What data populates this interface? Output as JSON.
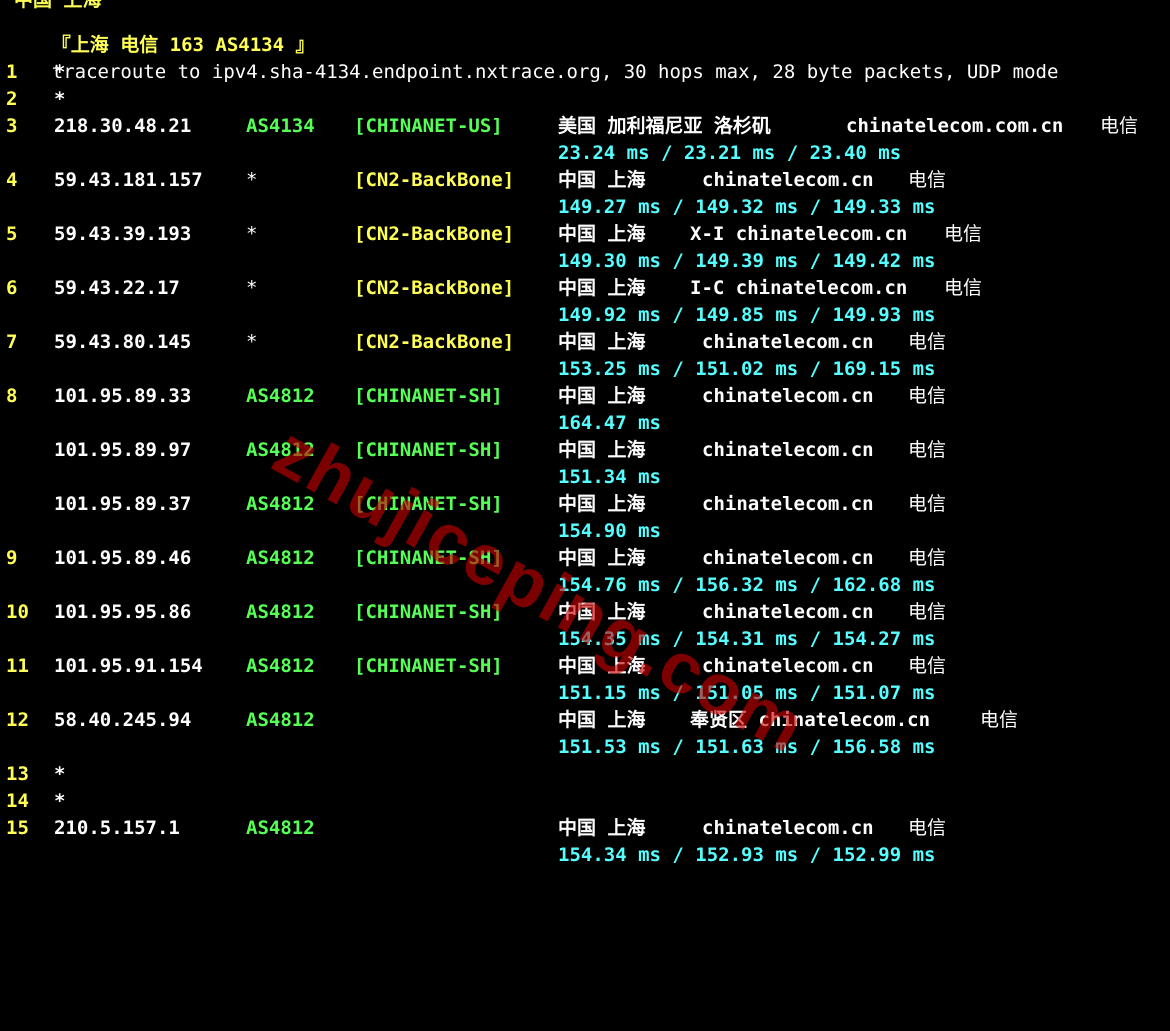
{
  "colors": {
    "background": "#000000",
    "text": "#ffffff",
    "hop": "#ffff55",
    "asn": "#55ff55",
    "tag_green": "#55ff55",
    "tag_yellow": "#ffff55",
    "rtt": "#55ffff",
    "watermark": "#c80000"
  },
  "cut_off_text": "中国 上海",
  "header": "『上海 电信 163 AS4134 』",
  "traceroute_line": "traceroute to ipv4.sha-4134.endpoint.nxtrace.org, 30 hops max, 28 byte packets, UDP mode",
  "hops": {
    "h1": {
      "hop": "1",
      "ip": "*"
    },
    "h2": {
      "hop": "2",
      "ip": "*"
    },
    "h3": {
      "hop": "3",
      "ip": "218.30.48.21",
      "asn": "AS4134",
      "tag": "[CHINANET-US]",
      "geo": "美国 加利福尼亚 洛杉矶",
      "host": "chinatelecom.com.cn",
      "isp": "电信",
      "rtt": "23.24 ms / 23.21 ms / 23.40 ms"
    },
    "h4": {
      "hop": "4",
      "ip": "59.43.181.157",
      "asn": "*",
      "tag": "[CN2-BackBone]",
      "geo": "中国 上海",
      "host": "chinatelecom.cn",
      "isp": "电信",
      "rtt": "149.27 ms / 149.32 ms / 149.33 ms"
    },
    "h5": {
      "hop": "5",
      "ip": "59.43.39.193",
      "asn": "*",
      "tag": "[CN2-BackBone]",
      "geo": "中国 上海",
      "host": "X-I chinatelecom.cn",
      "isp": "电信",
      "rtt": "149.30 ms / 149.39 ms / 149.42 ms"
    },
    "h6": {
      "hop": "6",
      "ip": "59.43.22.17",
      "asn": "*",
      "tag": "[CN2-BackBone]",
      "geo": "中国 上海",
      "host": "I-C chinatelecom.cn",
      "isp": "电信",
      "rtt": "149.92 ms / 149.85 ms / 149.93 ms"
    },
    "h7": {
      "hop": "7",
      "ip": "59.43.80.145",
      "asn": "*",
      "tag": "[CN2-BackBone]",
      "geo": "中国 上海",
      "host": "chinatelecom.cn",
      "isp": "电信",
      "rtt": "153.25 ms / 151.02 ms / 169.15 ms"
    },
    "h8a": {
      "hop": "8",
      "ip": "101.95.89.33",
      "asn": "AS4812",
      "tag": "[CHINANET-SH]",
      "geo": "中国 上海",
      "host": "chinatelecom.cn",
      "isp": "电信",
      "rtt": "164.47 ms"
    },
    "h8b": {
      "ip": "101.95.89.97",
      "asn": "AS4812",
      "tag": "[CHINANET-SH]",
      "geo": "中国 上海",
      "host": "chinatelecom.cn",
      "isp": "电信",
      "rtt": "151.34 ms"
    },
    "h8c": {
      "ip": "101.95.89.37",
      "asn": "AS4812",
      "tag": "[CHINANET-SH]",
      "geo": "中国 上海",
      "host": "chinatelecom.cn",
      "isp": "电信",
      "rtt": "154.90 ms"
    },
    "h9": {
      "hop": "9",
      "ip": "101.95.89.46",
      "asn": "AS4812",
      "tag": "[CHINANET-SH]",
      "geo": "中国 上海",
      "host": "chinatelecom.cn",
      "isp": "电信",
      "rtt": "154.76 ms / 156.32 ms / 162.68 ms"
    },
    "h10": {
      "hop": "10",
      "ip": "101.95.95.86",
      "asn": "AS4812",
      "tag": "[CHINANET-SH]",
      "geo": "中国 上海",
      "host": "chinatelecom.cn",
      "isp": "电信",
      "rtt": "154.35 ms / 154.31 ms / 154.27 ms"
    },
    "h11": {
      "hop": "11",
      "ip": "101.95.91.154",
      "asn": "AS4812",
      "tag": "[CHINANET-SH]",
      "geo": "中国 上海",
      "host": "chinatelecom.cn",
      "isp": "电信",
      "rtt": "151.15 ms / 151.05 ms / 151.07 ms"
    },
    "h12": {
      "hop": "12",
      "ip": "58.40.245.94",
      "asn": "AS4812",
      "geo": "中国 上海",
      "host": "奉贤区 chinatelecom.cn",
      "isp": "电信",
      "rtt": "151.53 ms / 151.63 ms / 156.58 ms"
    },
    "h13": {
      "hop": "13",
      "ip": "*"
    },
    "h14": {
      "hop": "14",
      "ip": "*"
    },
    "h15": {
      "hop": "15",
      "ip": "210.5.157.1",
      "asn": "AS4812",
      "geo": "中国 上海",
      "host": "chinatelecom.cn",
      "isp": "电信",
      "rtt": "154.34 ms / 152.93 ms / 152.99 ms"
    }
  },
  "watermark": "zhujiceping.com"
}
